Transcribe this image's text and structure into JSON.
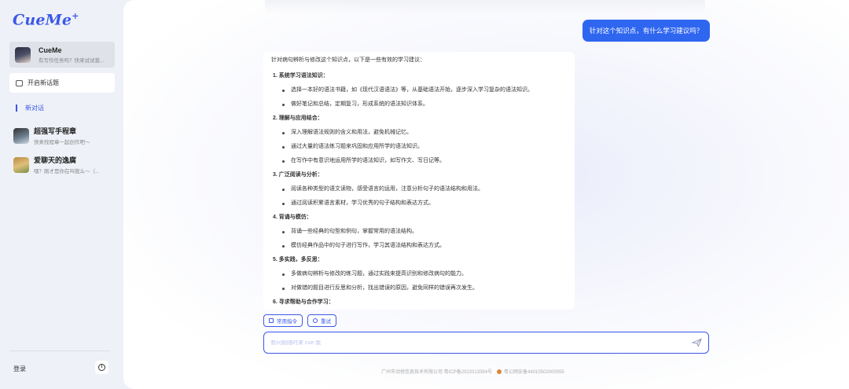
{
  "sidebar": {
    "logo": "CueMe",
    "logo_mark": "+",
    "bot_card": {
      "title": "CueMe",
      "subtitle": "有写作任务吗？快来试试我..."
    },
    "new_topic_label": "开启新话题",
    "new_chat_label": "新对话",
    "history": [
      {
        "title": "超强写手程章",
        "subtitle": "快来找程章一起创作吧～"
      },
      {
        "title": "爱聊天的逸腐",
        "subtitle": "嘿？刚才是你在叫我么～（..."
      }
    ],
    "login_label": "登录",
    "info_icon": "info-icon"
  },
  "chat": {
    "user_message": "针对这个知识点，有什么学习建议吗？",
    "answer": {
      "intro": "针对病句辨析与修改这个知识点，以下是一些有效的学习建议：",
      "sections": [
        {
          "title": "1. 系统学习语法知识：",
          "bullets": [
            "选择一本好的语法书籍，如《现代汉语语法》等，从基础语法开始，逐步深入学习复杂的语法知识。",
            "做好笔记和总结，定期复习，形成系统的语法知识体系。"
          ]
        },
        {
          "title": "2. 理解与应用结合：",
          "bullets": [
            "深入理解语法规则的含义和用法，避免机械记忆。",
            "通过大量的语法练习题来巩固和应用所学的语法知识。",
            "在写作中有意识地运用所学的语法知识，如写作文、写日记等。"
          ]
        },
        {
          "title": "3. 广泛阅读与分析：",
          "bullets": [
            "阅读各种类型的语文读物，感受语言的运用，注意分析句子的语法结构和用法。",
            "通过阅读积累语言素材，学习优秀的句子结构和表达方式。"
          ]
        },
        {
          "title": "4. 背诵与模仿：",
          "bullets": [
            "背诵一些经典的句型和例句，掌握常用的语法结构。",
            "模仿经典作品中的句子进行写作，学习其语法结构和表达方式。"
          ]
        },
        {
          "title": "5. 多实践，多反思：",
          "bullets": [
            "多做病句辨析与修改的练习题，通过实践来提高识别和修改病句的能力。",
            "对做错的题目进行反思和分析，找出错误的原因，避免同样的错误再次发生。"
          ]
        },
        {
          "title": "6. 寻求帮助与合作学习：",
          "bullets": []
        }
      ]
    },
    "actions": {
      "common_commands": "常用指令",
      "retry": "重试"
    },
    "input_placeholder": "有问题随时来 cue 我"
  },
  "footer": {
    "icp": "广州市动悦信息技术有限公司 粤ICP备2022013394号",
    "police": "粤公网安备44010502000055"
  },
  "colors": {
    "accent": "#3b57e8",
    "user_bubble": "#2f66f0"
  }
}
